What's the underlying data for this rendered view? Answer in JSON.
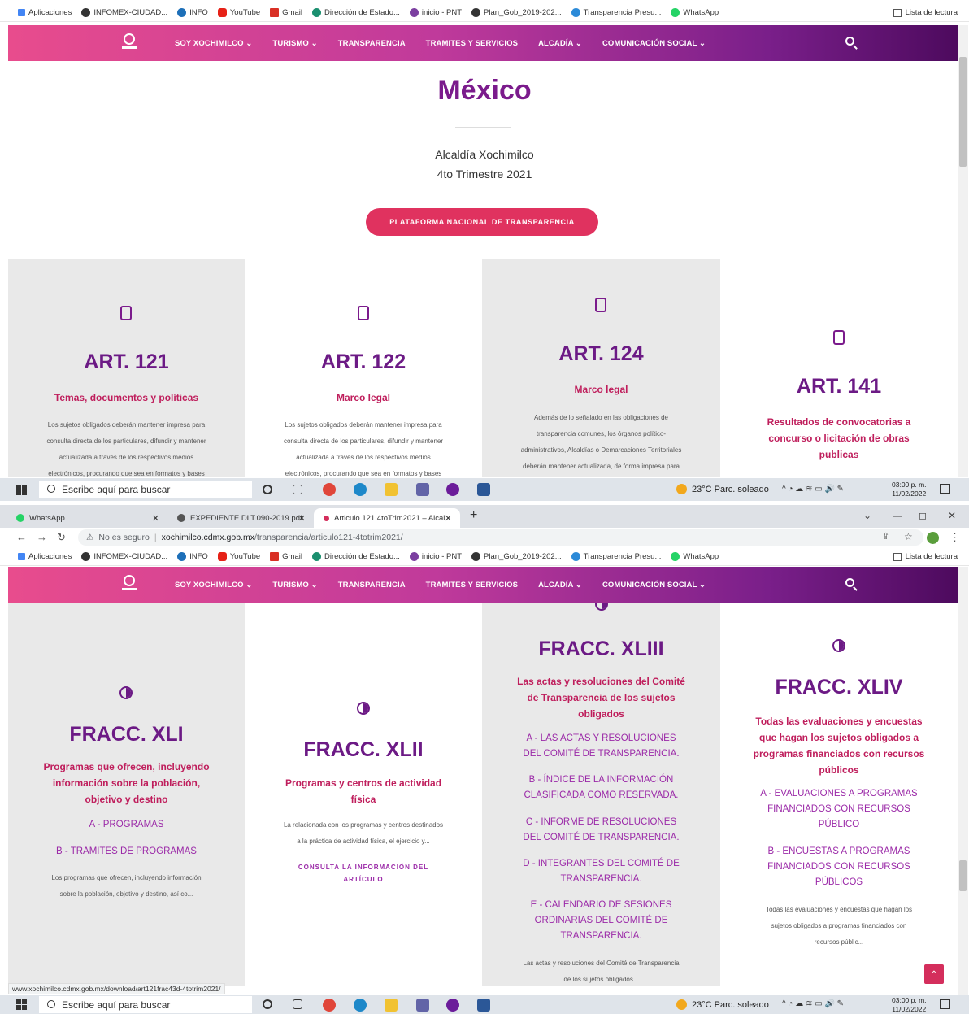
{
  "bookmarks": [
    "Aplicaciones",
    "INFOMEX-CIUDAD...",
    "INFO",
    "YouTube",
    "Gmail",
    "Dirección de Estado...",
    "inicio - PNT",
    "Plan_Gob_2019-202...",
    "Transparencia Presu...",
    "WhatsApp"
  ],
  "reading_list": "Lista de lectura",
  "nav": {
    "items": [
      "SOY XOCHIMILCO ⌄",
      "TURISMO ⌄",
      "TRANSPARENCIA",
      "TRAMITES Y SERVICIOS",
      "ALCADÍA ⌄",
      "COMUNICACIÓN SOCIAL ⌄"
    ]
  },
  "hero": {
    "title": "México",
    "subtitle1": "Alcaldía Xochimilco",
    "subtitle2": "4to Trimestre 2021",
    "button": "PLATAFORMA NACIONAL DE TRANSPARENCIA"
  },
  "articles": [
    {
      "title": "ART. 121",
      "subtitle": "Temas, documentos y políticas",
      "text": [
        "Los sujetos obligados deberán mantener impresa para",
        "consulta directa de los particulares, difundir y mantener",
        "actualizada a través de los respectivos medios",
        "electrónicos, procurando que sea en formatos y bases"
      ]
    },
    {
      "title": "ART. 122",
      "subtitle": "Marco legal",
      "text": [
        "Los sujetos obligados deberán mantener impresa para",
        "consulta directa de los particulares, difundir y mantener",
        "actualizada a través de los respectivos medios",
        "electrónicos, procurando que sea en formatos y bases"
      ]
    },
    {
      "title": "ART. 124",
      "subtitle": "Marco legal",
      "text": [
        "Además de lo señalado en las obligaciones de",
        "transparencia comunes, los órganos político-",
        "administrativos, Alcaldías o Demarcaciones Territoriales",
        "deberán mantener actualizada, de forma impresa para"
      ]
    },
    {
      "title": "ART. 141",
      "subtitle": [
        "Resultados de convocatorias a",
        "concurso o licitación de obras",
        "publicas"
      ]
    }
  ],
  "taskbar": {
    "search_placeholder": "Escribe aquí para buscar",
    "weather": "23°C  Parc. soleado",
    "time": "03:00 p. m.",
    "date": "11/02/2022"
  },
  "tabs": [
    {
      "label": "WhatsApp"
    },
    {
      "label": "EXPEDIENTE DLT.090-2019.pdf"
    },
    {
      "label": "Articulo 121 4toTrim2021 – Alcal"
    }
  ],
  "address": {
    "warning": "No es seguro",
    "host": "xochimilco.cdmx.gob.mx",
    "path": "/transparencia/articulo121-4totrim2021/"
  },
  "fracc": [
    {
      "title": "FRACC. XLI",
      "subtitle": [
        "Programas que ofrecen, incluyendo",
        "información sobre la población,",
        "objetivo y destino"
      ],
      "links": [
        "A - PROGRAMAS",
        "B - TRAMITES DE PROGRAMAS"
      ],
      "text": [
        "Los programas que ofrecen, incluyendo información",
        "sobre la población, objetivo y destino, así co..."
      ]
    },
    {
      "title": "FRACC. XLII",
      "subtitle": [
        "Programas y centros de actividad",
        "física"
      ],
      "text": [
        "La relacionada con los programas y centros destinados",
        "a la práctica de actividad física, el ejercicio y..."
      ],
      "consulta": [
        "CONSULTA LA INFORMACIÓN DEL",
        "ARTÍCULO"
      ]
    },
    {
      "title": "FRACC. XLIII",
      "subtitle": [
        "Las actas y resoluciones del Comité",
        "de Transparencia de los sujetos",
        "obligados"
      ],
      "links": [
        "A - LAS ACTAS Y RESOLUCIONES",
        "DEL COMITÉ DE TRANSPARENCIA.",
        "B - ÍNDICE DE LA INFORMACIÓN",
        "CLASIFICADA COMO RESERVADA.",
        "C - INFORME DE RESOLUCIONES",
        "DEL COMITÉ DE TRANSPARENCIA.",
        "D - INTEGRANTES DEL COMITÉ DE",
        "TRANSPARENCIA.",
        "E - CALENDARIO DE SESIONES",
        "ORDINARIAS DEL COMITÉ DE",
        "TRANSPARENCIA."
      ],
      "text": [
        "Las actas y resoluciones del Comité de Transparencia",
        "de los sujetos obligados..."
      ]
    },
    {
      "title": "FRACC. XLIV",
      "subtitle": [
        "Todas las evaluaciones y encuestas",
        "que hagan los sujetos obligados a",
        "programas financiados con recursos",
        "públicos"
      ],
      "links": [
        "A - EVALUACIONES A PROGRAMAS",
        "FINANCIADOS CON RECURSOS",
        "PÚBLICO",
        "B - ENCUESTAS A PROGRAMAS",
        "FINANCIADOS CON RECURSOS",
        "PÚBLICOS"
      ],
      "text": [
        "Todas las evaluaciones y encuestas que hagan los",
        "sujetos obligados a programas financiados con",
        "recursos públic..."
      ]
    }
  ],
  "status_url": "www.xochimilco.cdmx.gob.mx/download/art121frac43d-4totrim2021/",
  "colors": {
    "brand_purple": "#6c1a85",
    "accent_pink": "#bf1e5c",
    "button_pink": "#e0325f"
  }
}
